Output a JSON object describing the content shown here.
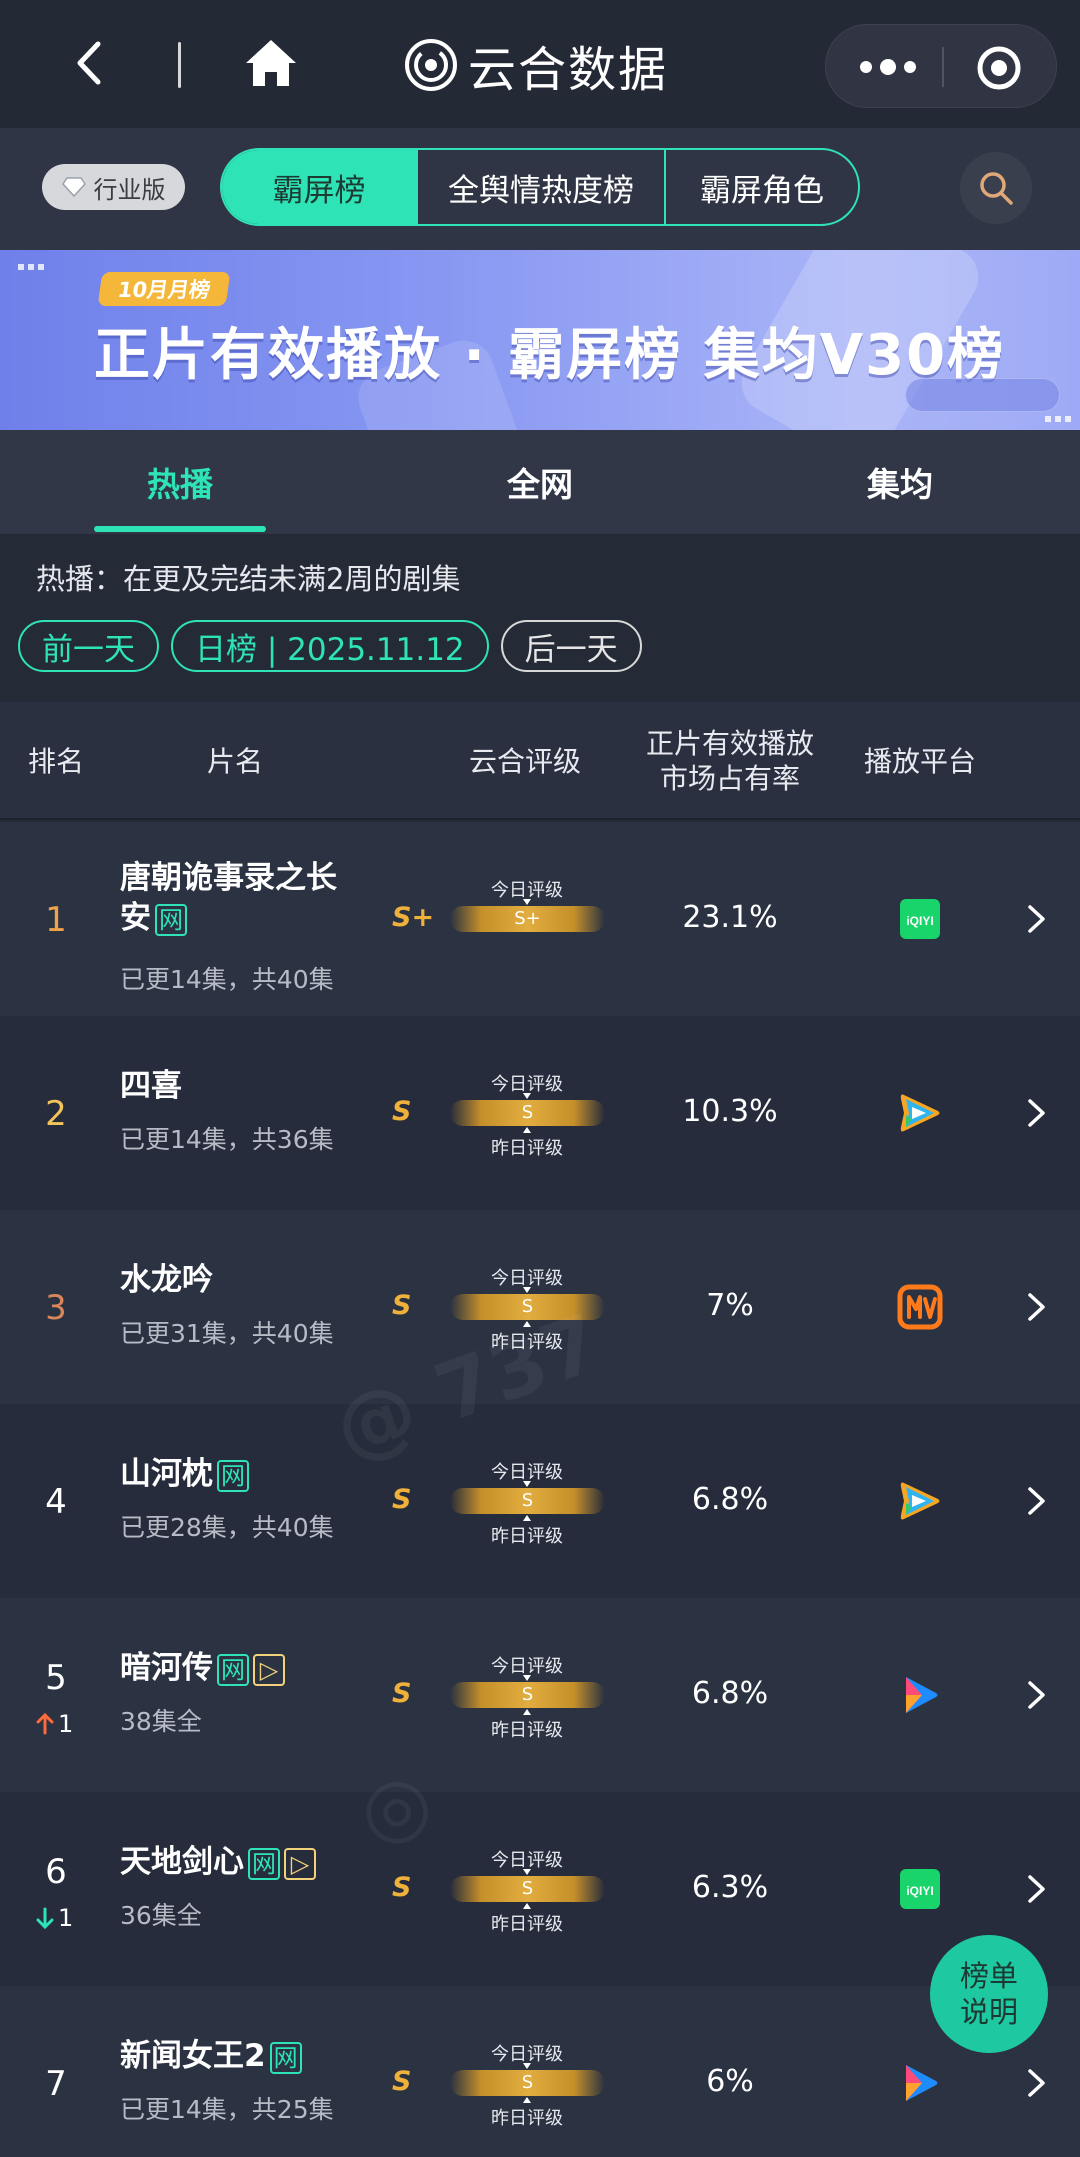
{
  "header": {
    "brand": "云合数据"
  },
  "nav": {
    "version_badge": "行业版",
    "segments": [
      "霸屏榜",
      "全舆情热度榜",
      "霸屏角色"
    ]
  },
  "banner": {
    "month_tag": "10月月榜",
    "title": "正片有效播放 · 霸屏榜 集均V30榜"
  },
  "tabs": [
    "热播",
    "全网",
    "集均"
  ],
  "info_text": "热播：在更及完结未满2周的剧集",
  "date_pills": {
    "prev": "前一天",
    "current": "日榜 | 2025.11.12",
    "next": "后一天"
  },
  "table_header": {
    "rank": "排名",
    "name": "片名",
    "grade": "云合评级",
    "share_line1": "正片有效播放",
    "share_line2": "市场占有率",
    "platform": "播放平台"
  },
  "gauge_labels": {
    "today": "今日评级",
    "yesterday": "昨日评级"
  },
  "rows": [
    {
      "rank": "1",
      "title_line1": "唐朝诡事录之长",
      "title_line2": "安",
      "tags": [
        "网"
      ],
      "sub": "已更14集，共40集",
      "grade": "S+",
      "gauge": "S+",
      "show_yesterday": false,
      "share": "23.1%",
      "platform": "iqiyi",
      "change": null,
      "rank_color": "#f0a24a"
    },
    {
      "rank": "2",
      "title_line1": "四喜",
      "title_line2": "",
      "tags": [],
      "sub": "已更14集，共36集",
      "grade": "S",
      "gauge": "S",
      "show_yesterday": true,
      "share": "10.3%",
      "platform": "tencent",
      "change": null,
      "rank_color": "#f2c45a"
    },
    {
      "rank": "3",
      "title_line1": "水龙吟",
      "title_line2": "",
      "tags": [],
      "sub": "已更31集，共40集",
      "grade": "S",
      "gauge": "S",
      "show_yesterday": true,
      "share": "7%",
      "platform": "mango",
      "change": null,
      "rank_color": "#d9875a"
    },
    {
      "rank": "4",
      "title_line1": "山河枕",
      "title_line2": "",
      "tags": [
        "网"
      ],
      "sub": "已更28集，共40集",
      "grade": "S",
      "gauge": "S",
      "show_yesterday": true,
      "share": "6.8%",
      "platform": "tencent",
      "change": null,
      "rank_color": "#ffffff"
    },
    {
      "rank": "5",
      "title_line1": "暗河传",
      "title_line2": "",
      "tags": [
        "网",
        "play"
      ],
      "sub": "38集全",
      "grade": "S",
      "gauge": "S",
      "show_yesterday": true,
      "share": "6.8%",
      "platform": "youku",
      "change": {
        "dir": "up",
        "value": "1"
      },
      "rank_color": "#ffffff"
    },
    {
      "rank": "6",
      "title_line1": "天地剑心",
      "title_line2": "",
      "tags": [
        "网",
        "play"
      ],
      "sub": "36集全",
      "grade": "S",
      "gauge": "S",
      "show_yesterday": true,
      "share": "6.3%",
      "platform": "iqiyi",
      "change": {
        "dir": "down",
        "value": "1"
      },
      "rank_color": "#ffffff"
    },
    {
      "rank": "7",
      "title_line1": "新闻女王2",
      "title_line2": "",
      "tags": [
        "网"
      ],
      "sub": "已更14集，共25集",
      "grade": "S",
      "gauge": "S",
      "show_yesterday": true,
      "share": "6%",
      "platform": "youku",
      "change": null,
      "rank_color": "#ffffff"
    }
  ],
  "faq_bubble": {
    "line1": "榜单",
    "line2": "说明"
  },
  "colors": {
    "accent": "#2ee3b6",
    "gold": "#f0b13a",
    "bg": "#252a37"
  }
}
